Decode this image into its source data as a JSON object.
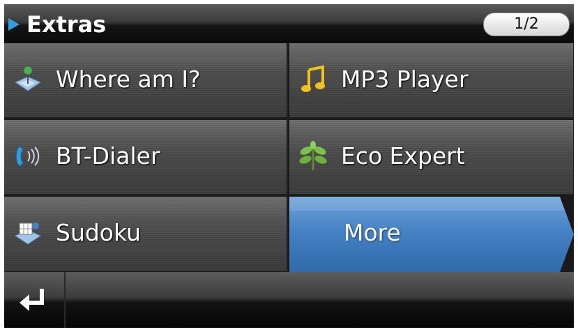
{
  "header": {
    "title": "Extras",
    "page_indicator": "1/2",
    "accent_color": "#2f9fe0"
  },
  "menu": {
    "items": [
      {
        "label": "Where am I?",
        "icon": "map-pin-icon"
      },
      {
        "label": "MP3 Player",
        "icon": "music-note-icon"
      },
      {
        "label": "BT-Dialer",
        "icon": "bluetooth-phone-icon"
      },
      {
        "label": "Eco Expert",
        "icon": "plant-icon"
      },
      {
        "label": "Sudoku",
        "icon": "sudoku-icon"
      }
    ],
    "more_label": "More",
    "more_color": "#3f7fc0"
  },
  "footer": {
    "back_icon": "return-arrow-icon"
  }
}
